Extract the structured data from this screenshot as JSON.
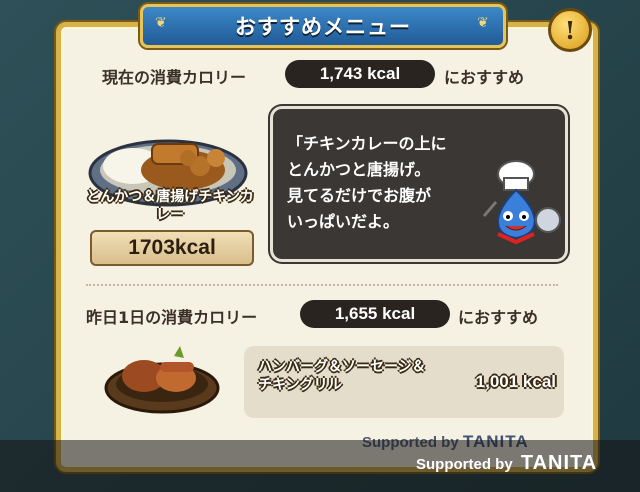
{
  "title": "おすすめメニュー",
  "alert_icon": "!",
  "today": {
    "label_before": "現在の消費カロリー",
    "kcal": "1,743 kcal",
    "label_after": "におすすめ",
    "food_name": "とんかつ＆唐揚げチキンカレー",
    "food_kcal": "1703kcal",
    "message": "「チキンカレーの上に\n  とんかつと唐揚げ。\n  見てるだけでお腹が\n  いっぱいだよ。"
  },
  "yesterday": {
    "label_before": "昨日1日の消費カロリー",
    "kcal": "1,655 kcal",
    "label_after": "におすすめ",
    "item_name": "ハンバーグ＆ソーセージ＆チキングリル",
    "item_kcal": "1,001 kcal"
  },
  "supported_by": "Supported by",
  "brand": "TANITA",
  "icons": {
    "alert": "exclamation-icon",
    "food1": "curry-plate-icon",
    "mascot": "slime-chef-icon",
    "food2": "grill-plate-icon"
  },
  "colors": {
    "banner": "#2f6fb0",
    "frame": "#d6b24a",
    "panel": "#f5f1e3",
    "pill": "#2a2420"
  }
}
